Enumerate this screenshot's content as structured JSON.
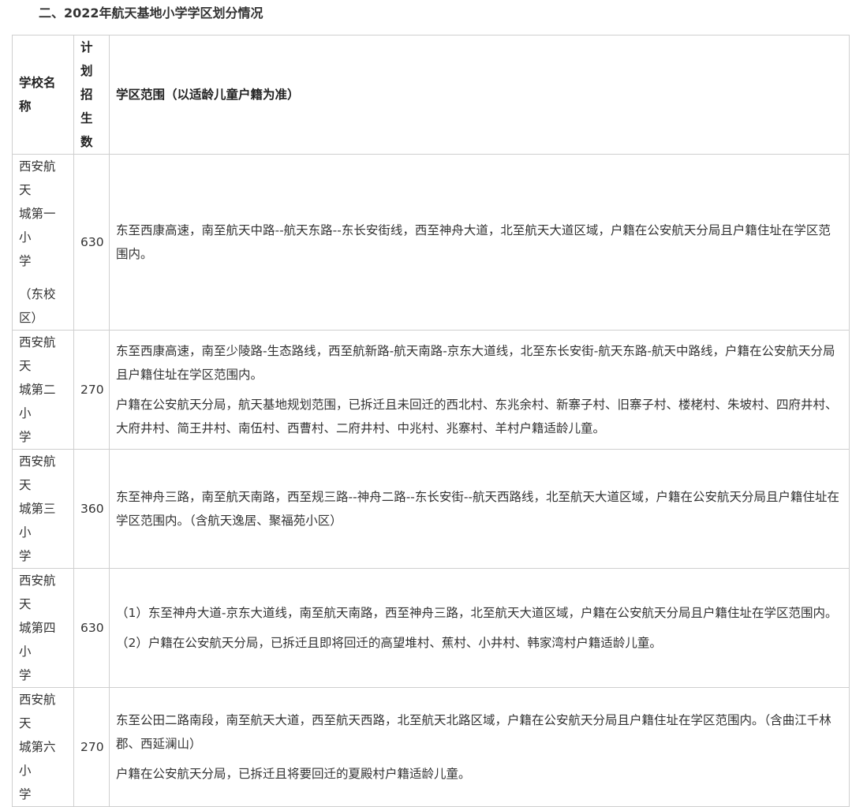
{
  "page_title": "二、2022年航天基地小学学区划分情况",
  "table": {
    "headers": {
      "school": "学校名称",
      "quota_lines": [
        "计划",
        "招生",
        "数"
      ],
      "scope": "学区范围（以适龄儿童户籍为准）"
    },
    "rows": [
      {
        "name_lines": [
          "西安航天",
          "城第一小",
          "学"
        ],
        "name_sub_lines": [
          "（东校",
          "区）"
        ],
        "quota": "630",
        "scope_paragraphs": [
          "东至西康高速，南至航天中路--航天东路--东长安街线，西至神舟大道，北至航天大道区域，户籍在公安航天分局且户籍住址在学区范围内。"
        ]
      },
      {
        "name_lines": [
          "西安航天",
          "城第二小",
          "学"
        ],
        "quota": "270",
        "scope_paragraphs": [
          "东至西康高速，南至少陵路-生态路线，西至航新路-航天南路-京东大道线，北至东长安街-航天东路-航天中路线，户籍在公安航天分局且户籍住址在学区范围内。",
          "户籍在公安航天分局，航天基地规划范围，已拆迁且未回迁的西北村、东兆余村、新寨子村、旧寨子村、楼栳村、朱坡村、四府井村、大府井村、简王井村、南伍村、西曹村、二府井村、中兆村、兆寨村、羊村户籍适龄儿童。"
        ]
      },
      {
        "name_lines": [
          "西安航天",
          "城第三小",
          "学"
        ],
        "quota": "360",
        "scope_paragraphs": [
          "东至神舟三路，南至航天南路，西至规三路--神舟二路--东长安街--航天西路线，北至航天大道区域，户籍在公安航天分局且户籍住址在学区范围内。（含航天逸居、聚福苑小区）"
        ]
      },
      {
        "name_lines": [
          "西安航天",
          "城第四小",
          "学"
        ],
        "quota": "630",
        "scope_paragraphs": [
          "（1）东至神舟大道-京东大道线，南至航天南路，西至神舟三路，北至航天大道区域，户籍在公安航天分局且户籍住址在学区范围内。",
          "（2）户籍在公安航天分局，已拆迁且即将回迁的高望堆村、蕉村、小井村、韩家湾村户籍适龄儿童。"
        ]
      },
      {
        "name_lines": [
          "西安航天",
          "城第六小",
          "学"
        ],
        "quota": "270",
        "scope_paragraphs": [
          "东至公田二路南段，南至航天大道，西至航天西路，北至航天北路区域，户籍在公安航天分局且户籍住址在学区范围内。（含曲江千林郡、西延澜山）",
          "户籍在公安航天分局，已拆迁且将要回迁的夏殿村户籍适龄儿童。"
        ]
      }
    ]
  }
}
